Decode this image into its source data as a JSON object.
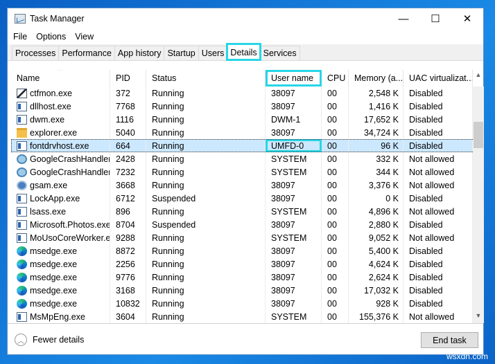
{
  "window": {
    "title": "Task Manager",
    "minimize": "—",
    "maximize": "☐",
    "close": "✕"
  },
  "menu": [
    "File",
    "Options",
    "View"
  ],
  "tabs": [
    "Processes",
    "Performance",
    "App history",
    "Startup",
    "Users",
    "Details",
    "Services"
  ],
  "active_tab": "Details",
  "columns": [
    "Name",
    "PID",
    "Status",
    "User name",
    "CPU",
    "Memory (a...",
    "UAC virtualizat..."
  ],
  "rows": [
    {
      "icon": "pen",
      "name": "ctfmon.exe",
      "pid": "372",
      "status": "Running",
      "user": "38097",
      "cpu": "00",
      "mem": "2,548 K",
      "uac": "Disabled"
    },
    {
      "icon": "win-app",
      "name": "dllhost.exe",
      "pid": "7768",
      "status": "Running",
      "user": "38097",
      "cpu": "00",
      "mem": "1,416 K",
      "uac": "Disabled"
    },
    {
      "icon": "win-app",
      "name": "dwm.exe",
      "pid": "1116",
      "status": "Running",
      "user": "DWM-1",
      "cpu": "00",
      "mem": "17,652 K",
      "uac": "Disabled"
    },
    {
      "icon": "folder",
      "name": "explorer.exe",
      "pid": "5040",
      "status": "Running",
      "user": "38097",
      "cpu": "00",
      "mem": "34,724 K",
      "uac": "Disabled"
    },
    {
      "icon": "win-app",
      "name": "fontdrvhost.exe",
      "pid": "664",
      "status": "Running",
      "user": "UMFD-0",
      "cpu": "00",
      "mem": "96 K",
      "uac": "Disabled",
      "selected": true
    },
    {
      "icon": "crash",
      "name": "GoogleCrashHandler...",
      "pid": "2428",
      "status": "Running",
      "user": "SYSTEM",
      "cpu": "00",
      "mem": "332 K",
      "uac": "Not allowed"
    },
    {
      "icon": "crash",
      "name": "GoogleCrashHandler...",
      "pid": "7232",
      "status": "Running",
      "user": "SYSTEM",
      "cpu": "00",
      "mem": "344 K",
      "uac": "Not allowed"
    },
    {
      "icon": "gear",
      "name": "gsam.exe",
      "pid": "3668",
      "status": "Running",
      "user": "38097",
      "cpu": "00",
      "mem": "3,376 K",
      "uac": "Not allowed"
    },
    {
      "icon": "win-app",
      "name": "LockApp.exe",
      "pid": "6712",
      "status": "Suspended",
      "user": "38097",
      "cpu": "00",
      "mem": "0 K",
      "uac": "Disabled"
    },
    {
      "icon": "win-app",
      "name": "lsass.exe",
      "pid": "896",
      "status": "Running",
      "user": "SYSTEM",
      "cpu": "00",
      "mem": "4,896 K",
      "uac": "Not allowed"
    },
    {
      "icon": "win-app",
      "name": "Microsoft.Photos.exe",
      "pid": "8704",
      "status": "Suspended",
      "user": "38097",
      "cpu": "00",
      "mem": "2,880 K",
      "uac": "Disabled"
    },
    {
      "icon": "win-app",
      "name": "MoUsoCoreWorker.e...",
      "pid": "9288",
      "status": "Running",
      "user": "SYSTEM",
      "cpu": "00",
      "mem": "9,052 K",
      "uac": "Not allowed"
    },
    {
      "icon": "edge",
      "name": "msedge.exe",
      "pid": "8872",
      "status": "Running",
      "user": "38097",
      "cpu": "00",
      "mem": "5,400 K",
      "uac": "Disabled"
    },
    {
      "icon": "edge",
      "name": "msedge.exe",
      "pid": "2256",
      "status": "Running",
      "user": "38097",
      "cpu": "00",
      "mem": "4,624 K",
      "uac": "Disabled"
    },
    {
      "icon": "edge",
      "name": "msedge.exe",
      "pid": "9776",
      "status": "Running",
      "user": "38097",
      "cpu": "00",
      "mem": "2,624 K",
      "uac": "Disabled"
    },
    {
      "icon": "edge",
      "name": "msedge.exe",
      "pid": "3168",
      "status": "Running",
      "user": "38097",
      "cpu": "00",
      "mem": "17,032 K",
      "uac": "Disabled"
    },
    {
      "icon": "edge",
      "name": "msedge.exe",
      "pid": "10832",
      "status": "Running",
      "user": "38097",
      "cpu": "00",
      "mem": "928 K",
      "uac": "Disabled"
    },
    {
      "icon": "win-app",
      "name": "MsMpEng.exe",
      "pid": "3604",
      "status": "Running",
      "user": "SYSTEM",
      "cpu": "00",
      "mem": "155,376 K",
      "uac": "Not allowed"
    }
  ],
  "footer": {
    "fewer_details": "Fewer details",
    "end_task": "End task"
  },
  "watermark": "wsxdn.com",
  "highlight_color": "#26d6e6"
}
